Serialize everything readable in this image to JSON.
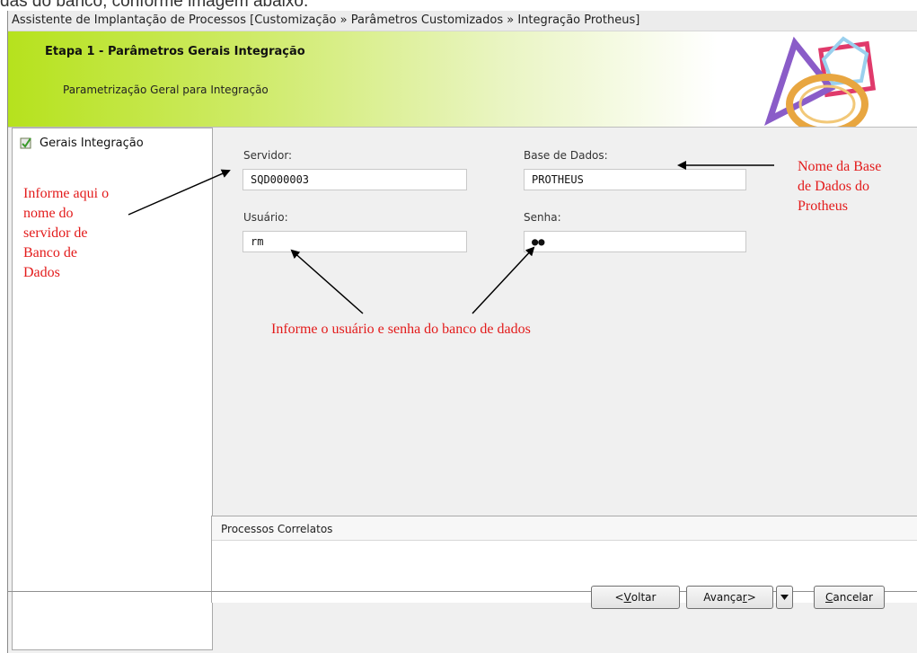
{
  "background_text": "das do banco, conforme imagem abaixo.",
  "window": {
    "title": "Assistente de Implantação de Processos [Customização » Parâmetros Customizados » Integração Protheus]"
  },
  "header": {
    "step_title": "Etapa 1 - Parâmetros Gerais Integração",
    "step_subtitle": "Parametrização Geral para Integração",
    "logo_icon": "shapes-logo-icon"
  },
  "sidebar": {
    "items": [
      {
        "label": "Gerais Integração",
        "icon": "checklist-icon"
      }
    ]
  },
  "form": {
    "server": {
      "label": "Servidor:",
      "value": "SQD000003"
    },
    "database": {
      "label": "Base de Dados:",
      "value": "PROTHEUS"
    },
    "user": {
      "label": "Usuário:",
      "value": "rm"
    },
    "password": {
      "label": "Senha:",
      "value": "●●"
    }
  },
  "related": {
    "title": "Processos Correlatos"
  },
  "buttons": {
    "back_prefix": "< ",
    "back_hotkey": "V",
    "back_rest": "oltar",
    "next_prefix": "Avança",
    "next_hotkey": "r",
    "next_suffix": " >",
    "cancel_hotkey": "C",
    "cancel_rest": "ancelar"
  },
  "annotations": {
    "server_note": [
      "Informe aqui o",
      "nome do",
      "servidor de",
      "Banco de",
      "Dados"
    ],
    "database_note": [
      "Nome da Base",
      "de Dados do",
      "Protheus"
    ],
    "credentials_note": "Informe o usuário e senha do banco de dados"
  },
  "colors": {
    "annotation": "#e31b1b",
    "header_accent": "#b6e21d"
  }
}
